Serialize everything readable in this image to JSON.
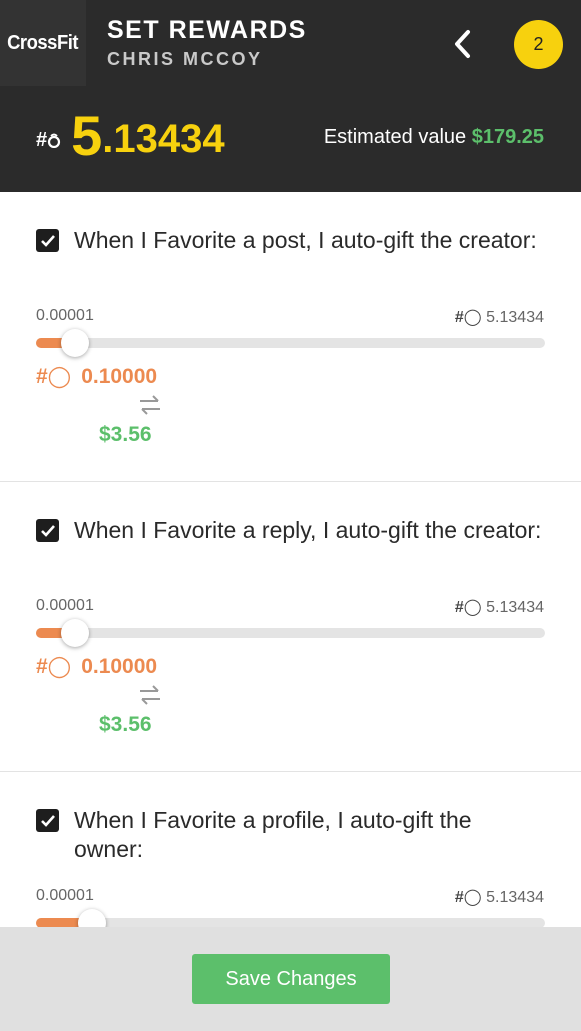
{
  "header": {
    "logo": "CrossFit",
    "title": "SET REWARDS",
    "subtitle": "CHRIS MCCOY",
    "badge_count": "2",
    "token_symbol": "#☃",
    "balance_int": "5",
    "balance_dec": ".13434",
    "estimated_label": "Estimated value ",
    "estimated_value": "$179.25"
  },
  "rewards": [
    {
      "checked": true,
      "text": "When I Favorite a post, I auto-gift the creator:",
      "min": "0.00001",
      "max": "5.13434",
      "amount": "0.10000",
      "usd": "$3.56",
      "slider_level": 0.019
    },
    {
      "checked": true,
      "text": "When I Favorite a reply, I auto-gift the creator:",
      "min": "0.00001",
      "max": "5.13434",
      "amount": "0.10000",
      "usd": "$3.56",
      "slider_level": 0.019
    },
    {
      "checked": true,
      "text": "When I Favorite a profile, I auto-gift the owner:",
      "min": "0.00001",
      "max": "5.13434",
      "slider_level": 0.06
    }
  ],
  "footer": {
    "save_label": "Save Changes"
  },
  "colors": {
    "header_bg": "#2b2b2b",
    "accent_yellow": "#f7d10e",
    "accent_orange": "#ec8a50",
    "accent_green": "#5cbf6b"
  },
  "icons": {
    "back": "chevron-left-icon",
    "checkbox": "checkmark-icon",
    "swap": "swap-arrows-icon",
    "token": "token-symbol-icon"
  }
}
